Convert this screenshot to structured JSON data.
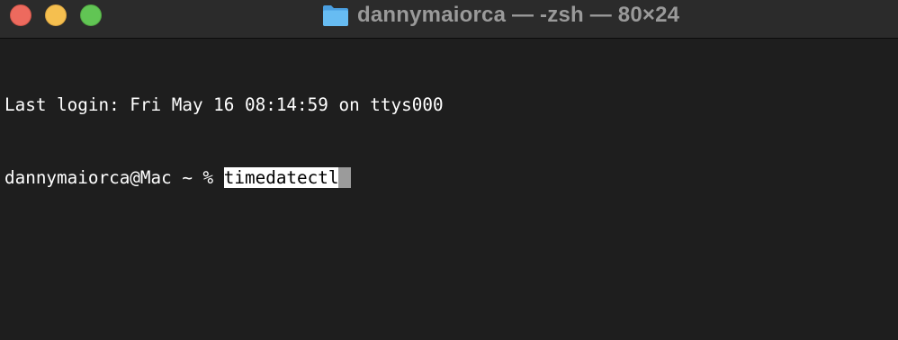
{
  "window": {
    "title": "dannymaiorca — -zsh — 80×24",
    "icon": "folder-icon",
    "traffic_lights": [
      "close",
      "minimize",
      "zoom"
    ]
  },
  "terminal": {
    "last_login": "Last login: Fri May 16 08:14:59 on ttys000",
    "prompt": "dannymaiorca@Mac ~ % ",
    "command": "timedatectl"
  },
  "colors": {
    "background": "#1e1e1e",
    "titlebar": "#2b2b2b",
    "text": "#ffffff",
    "close": "#ed6a5e",
    "minimize": "#f5bf4f",
    "zoom": "#61c554",
    "folder": "#5ab1ea"
  }
}
